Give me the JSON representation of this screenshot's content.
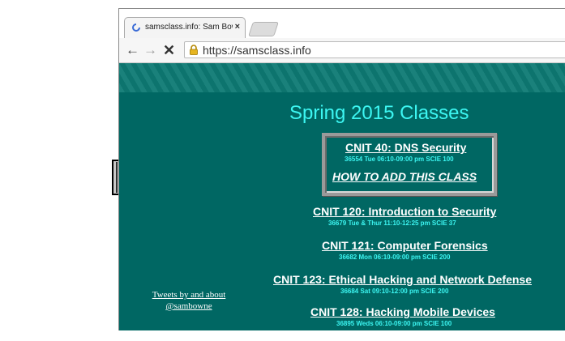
{
  "browser": {
    "tab_title": "samsclass.info: Sam Bowne",
    "tab_close": "×",
    "url": "https://samsclass.info"
  },
  "page": {
    "banner_link": "",
    "heading": "Spring 2015 Classes",
    "featured": {
      "title": "CNIT 40: DNS Security",
      "detail": "36554 Tue 06:10-09:00 pm SCIE 100",
      "howto": "HOW TO ADD THIS CLASS"
    },
    "courses": [
      {
        "title": "CNIT 120: Introduction to Security",
        "detail": "36679 Tue & Thur 11:10-12:25 pm SCIE 37"
      },
      {
        "title": "CNIT 121: Computer Forensics",
        "detail": "36682 Mon 06:10-09:00 pm SCIE 200"
      },
      {
        "title": "CNIT 123: Ethical Hacking and Network Defense",
        "detail": "36684 Sat 09:10-12:00 pm SCIE 200"
      },
      {
        "title": "CNIT 128: Hacking Mobile Devices",
        "detail": "36895 Weds 06:10-09:00 pm SCIE 100"
      }
    ],
    "tweets": {
      "line1": "Tweets by and about",
      "line2": "@sambowne"
    }
  },
  "colors": {
    "page_bg": "#006763",
    "heading": "#3cf6f2",
    "link": "#ffffff"
  },
  "icons": [
    "pointing-hand-icon",
    "loading-spinner-icon",
    "back-arrow-icon",
    "forward-arrow-icon",
    "stop-icon",
    "lock-icon"
  ]
}
